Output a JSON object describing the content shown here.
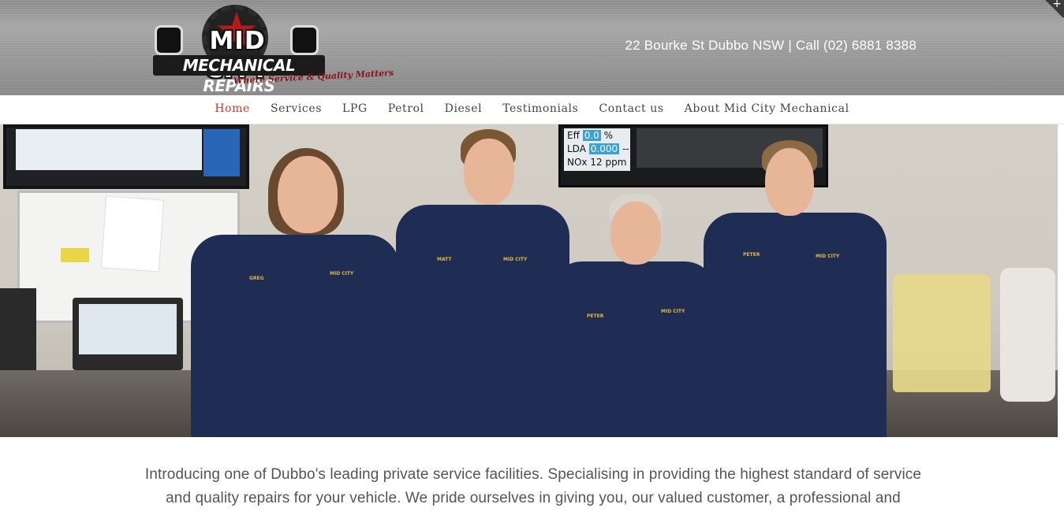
{
  "header": {
    "logo": {
      "line1": "MID CITY",
      "line2": "MECHANICAL REPAIRS",
      "tagline": "Where Service & Quality Matters"
    },
    "contact": "22 Bourke St Dubbo NSW | Call (02) 6881 8388",
    "corner_icon": "+"
  },
  "nav": {
    "items": [
      {
        "label": "Home",
        "active": true
      },
      {
        "label": "Services",
        "active": false
      },
      {
        "label": "LPG",
        "active": false
      },
      {
        "label": "Petrol",
        "active": false
      },
      {
        "label": "Diesel",
        "active": false
      },
      {
        "label": "Testimonials",
        "active": false
      },
      {
        "label": "Contact us",
        "active": false
      },
      {
        "label": "About Mid City Mechanical",
        "active": false
      }
    ]
  },
  "hero": {
    "readout": [
      {
        "label": "Eff",
        "value": "0.0",
        "unit": "%"
      },
      {
        "label": "LDA",
        "value": "0.000",
        "unit": "--"
      },
      {
        "label": "NOx",
        "value": "12",
        "unit": "ppm"
      }
    ],
    "people": [
      {
        "name_patch": "GREG",
        "logo_patch": "MID CITY"
      },
      {
        "name_patch": "MATT",
        "logo_patch": "MID CITY"
      },
      {
        "name_patch": "PETER",
        "logo_patch": "MID CITY"
      },
      {
        "name_patch": "PETER",
        "logo_patch": "MID CITY"
      }
    ]
  },
  "intro": {
    "text": "Introducing one of Dubbo's leading private service facilities. Specialising in providing the highest standard of service and quality repairs for your vehicle. We pride ourselves in giving you, our valued customer, a professional and"
  },
  "colors": {
    "accent": "#c0392b",
    "uniform": "#1f2d55",
    "logo_red": "#b4191c"
  }
}
